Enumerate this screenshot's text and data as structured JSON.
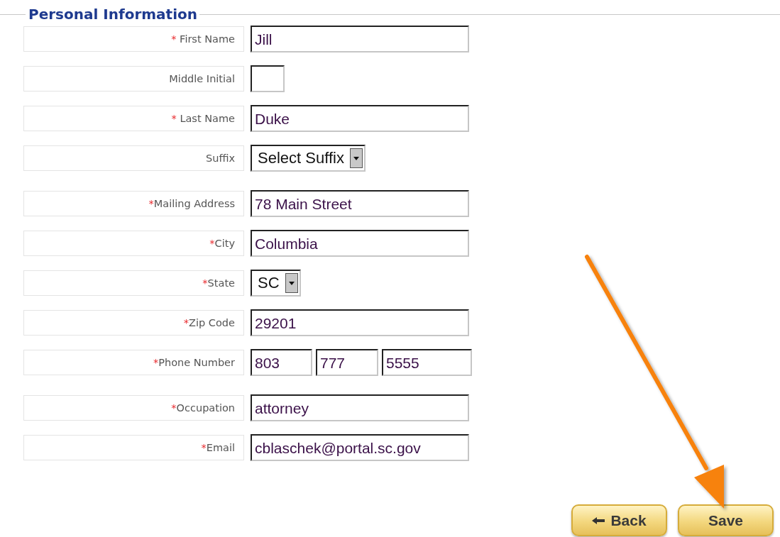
{
  "section": {
    "title": "Personal Information"
  },
  "groups": [
    {
      "rows": [
        {
          "label": "First Name",
          "mark": "* ",
          "kind": "text",
          "value": "Jill"
        },
        {
          "label": "Middle Initial",
          "kind": "short",
          "value": ""
        },
        {
          "label": "Last Name",
          "mark": "* ",
          "kind": "text",
          "value": "Duke"
        },
        {
          "label": "Suffix",
          "kind": "select",
          "value": "Select Suffix"
        }
      ]
    },
    {
      "rows": [
        {
          "label": "Mailing Address",
          "mark": "*",
          "kind": "text",
          "value": "78 Main Street"
        },
        {
          "label": "City",
          "mark": "*",
          "kind": "text",
          "value": "Columbia"
        },
        {
          "label": "State",
          "mark": "*",
          "kind": "select",
          "value": "SC"
        },
        {
          "label": "Zip Code",
          "mark": "*",
          "kind": "text",
          "value": "29201"
        },
        {
          "label": "Phone Number",
          "mark": "*",
          "kind": "phone",
          "parts": [
            "803",
            "777",
            "5555"
          ]
        }
      ]
    },
    {
      "rows": [
        {
          "label": "Occupation",
          "mark": "*",
          "kind": "text",
          "value": "attorney"
        },
        {
          "label": "Email",
          "mark": "*",
          "kind": "text",
          "value": "cblaschek@portal.sc.gov"
        }
      ]
    }
  ],
  "buttons": [
    {
      "label": "Back",
      "kind": "back"
    },
    {
      "label": "Save",
      "kind": "save"
    }
  ]
}
